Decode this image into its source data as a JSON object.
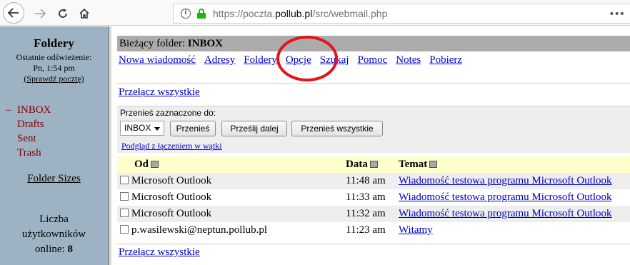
{
  "browser": {
    "url_prefix": "https://poczta.",
    "url_domain": "pollub.pl",
    "url_suffix": "/src/webmail.php",
    "menu_icon": "more-dots-icon"
  },
  "left": {
    "title": "Foldery",
    "refresh_label": "Ostatnie odświeżenie:",
    "refresh_time": "Pn, 1:54 pm",
    "check_mail": "(Sprawdź pocztę)",
    "folders": [
      {
        "marker": "–",
        "name": "INBOX"
      },
      {
        "marker": "",
        "name": "Drafts"
      },
      {
        "marker": "",
        "name": "Sent"
      },
      {
        "marker": "",
        "name": "Trash"
      }
    ],
    "folder_sizes": "Folder Sizes",
    "users_line1": "Liczba",
    "users_line2": "użytkowników",
    "users_line3": "online:",
    "users_count": "8"
  },
  "main": {
    "current_folder_label": "Bieżący folder:",
    "current_folder": "INBOX",
    "menu": [
      "Nowa wiadomość",
      "Adresy",
      "Foldery",
      "Opcje",
      "Szukaj",
      "Pomoc",
      "Notes",
      "Pobierz"
    ],
    "toggle_all": "Przełącz wszystkie",
    "move_label": "Przenieś zaznaczone do:",
    "move_select": "INBOX",
    "btn_move": "Przenieś",
    "btn_forward": "Prześlij dalej",
    "btn_move_all": "Przenieś wszystkie",
    "thread_view": "Podgląd z łączeniem w wątki",
    "columns": {
      "from": "Od",
      "date": "Data",
      "subject": "Temat"
    },
    "messages": [
      {
        "from": "Microsoft Outlook",
        "date": "11:48 am",
        "subject": "Wiadomość testowa programu Microsoft Outlook"
      },
      {
        "from": "Microsoft Outlook",
        "date": "11:33 am",
        "subject": "Wiadomość testowa programu Microsoft Outlook"
      },
      {
        "from": "Microsoft Outlook",
        "date": "11:32 am",
        "subject": "Wiadomość testowa programu Microsoft Outlook"
      },
      {
        "from": "p.wasilewski@neptun.pollub.pl",
        "date": "11:23 am",
        "subject": "Witamy"
      }
    ]
  },
  "colors": {
    "highlight_circle": "#e3141a",
    "left_frame": "#9db3c3",
    "folder_bar": "#ababab",
    "header_row": "#ffffcc"
  }
}
